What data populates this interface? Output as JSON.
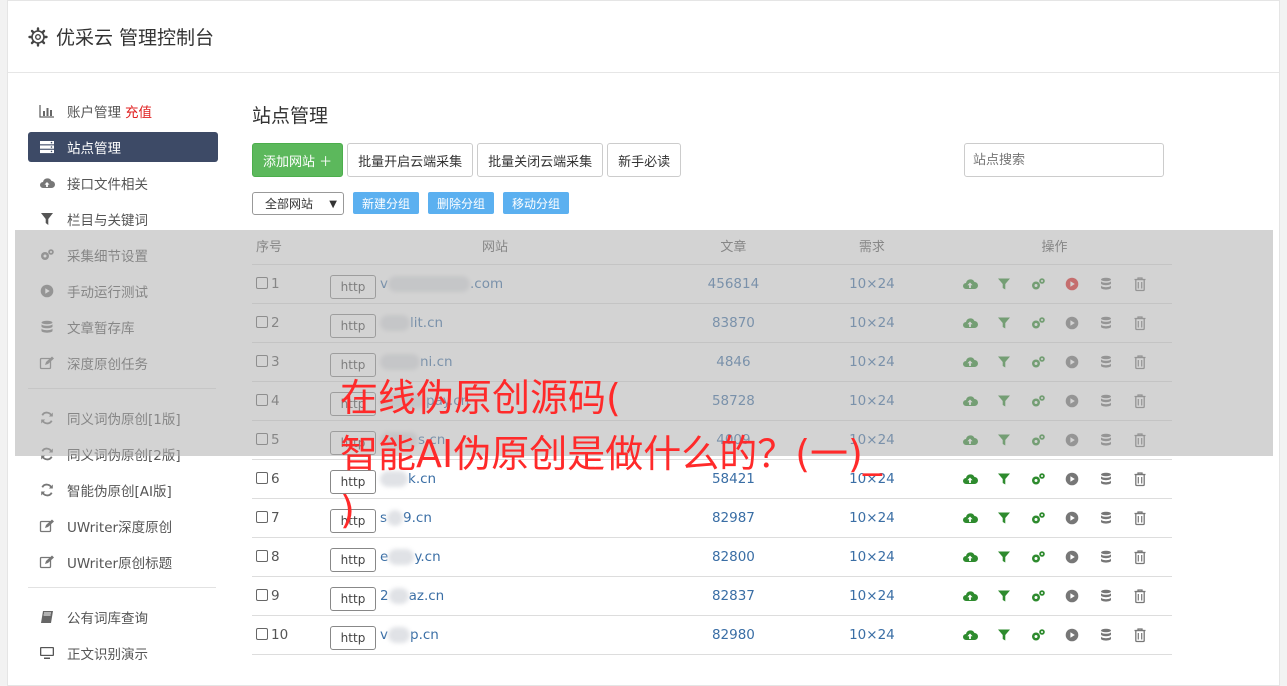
{
  "app": {
    "title": "优采云 管理控制台"
  },
  "sidebar": {
    "groups": [
      [
        {
          "label": "账户管理",
          "extra": "充值",
          "icon": "bar-chart-icon"
        },
        {
          "label": "站点管理",
          "icon": "server-icon",
          "active": true
        },
        {
          "label": "接口文件相关",
          "icon": "cloud-upload-icon"
        },
        {
          "label": "栏目与关键词",
          "icon": "filter-icon"
        },
        {
          "label": "采集细节设置",
          "icon": "cogs-icon"
        },
        {
          "label": "手动运行测试",
          "icon": "play-circle-icon"
        },
        {
          "label": "文章暂存库",
          "icon": "database-icon"
        },
        {
          "label": "深度原创任务",
          "icon": "edit-icon"
        }
      ],
      [
        {
          "label": "同义词伪原创[1版]",
          "icon": "refresh-icon"
        },
        {
          "label": "同义词伪原创[2版]",
          "icon": "refresh-icon"
        },
        {
          "label": "智能伪原创[AI版]",
          "icon": "refresh-icon"
        },
        {
          "label": "UWriter深度原创",
          "icon": "edit-icon"
        },
        {
          "label": "UWriter原创标题",
          "icon": "edit-icon"
        }
      ],
      [
        {
          "label": "公有词库查询",
          "icon": "book-icon"
        },
        {
          "label": "正文识别演示",
          "icon": "monitor-icon"
        }
      ]
    ]
  },
  "main": {
    "title": "站点管理",
    "buttons": {
      "add": "添加网站 ＋",
      "enable_all": "批量开启云端采集",
      "disable_all": "批量关闭云端采集",
      "guide": "新手必读"
    },
    "search": {
      "placeholder": "站点搜索"
    },
    "group_select": {
      "value": "全部网站"
    },
    "group_buttons": {
      "new": "新建分组",
      "delete": "删除分组",
      "move": "移动分组"
    },
    "table": {
      "headers": {
        "idx": "序号",
        "site": "网站",
        "articles": "文章",
        "demand": "需求",
        "ops": "操作"
      },
      "rows": [
        {
          "idx": "1",
          "proto": "http",
          "pre": "v",
          "post": ".com",
          "articles": "456814",
          "demand": "10×24",
          "play_active": true
        },
        {
          "idx": "2",
          "proto": "http",
          "pre": "",
          "post": "lit.cn",
          "articles": "83870",
          "demand": "10×24",
          "play_active": false
        },
        {
          "idx": "3",
          "proto": "http",
          "pre": "",
          "post": "ni.cn",
          "articles": "4846",
          "demand": "10×24",
          "play_active": false
        },
        {
          "idx": "4",
          "proto": "http",
          "pre": "",
          "post": "pay.cn",
          "articles": "58728",
          "demand": "10×24",
          "play_active": false
        },
        {
          "idx": "5",
          "proto": "http",
          "pre": "",
          "post": "s.cn",
          "articles": "4009",
          "demand": "10×24",
          "play_active": false
        },
        {
          "idx": "6",
          "proto": "http",
          "pre": "",
          "post": "k.cn",
          "articles": "58421",
          "demand": "10×24",
          "play_active": false
        },
        {
          "idx": "7",
          "proto": "http",
          "pre": "s",
          "post": "9.cn",
          "articles": "82987",
          "demand": "10×24",
          "play_active": false
        },
        {
          "idx": "8",
          "proto": "http",
          "pre": "e",
          "post": "y.cn",
          "articles": "82800",
          "demand": "10×24",
          "play_active": false
        },
        {
          "idx": "9",
          "proto": "http",
          "pre": "2",
          "post": "az.cn",
          "articles": "82837",
          "demand": "10×24",
          "play_active": false
        },
        {
          "idx": "10",
          "proto": "http",
          "pre": "v",
          "post": "p.cn",
          "articles": "82980",
          "demand": "10×24",
          "play_active": false
        }
      ]
    }
  },
  "overlay": {
    "line1": "在线伪原创源码(",
    "line2": "智能AI伪原创是做什么的？(一)_",
    "line3": ")"
  },
  "colors": {
    "green": "#2e8b2e",
    "red": "#e02020",
    "gray": "#777777",
    "active_nav": "#3d4a66"
  }
}
